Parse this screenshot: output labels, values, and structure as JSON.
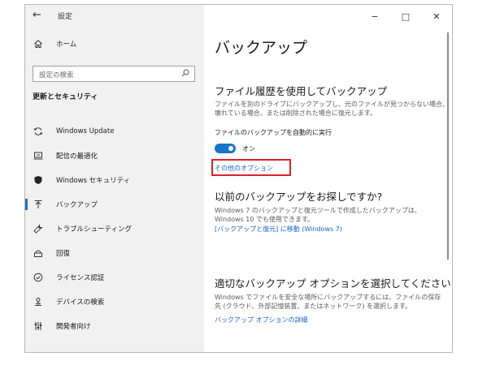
{
  "window": {
    "title": "設定",
    "back_glyph": "←",
    "controls": {
      "minimize": "−",
      "maximize": "□",
      "close": "✕"
    }
  },
  "sidebar": {
    "home_label": "ホーム",
    "search": {
      "placeholder": "設定の検索"
    },
    "section_title": "更新とセキュリティ",
    "items": [
      {
        "label": "Windows Update",
        "icon": "sync-icon"
      },
      {
        "label": "配信の最適化",
        "icon": "delivery-icon"
      },
      {
        "label": "Windows セキュリティ",
        "icon": "shield-icon"
      },
      {
        "label": "バックアップ",
        "icon": "backup-icon",
        "active": true
      },
      {
        "label": "トラブルシューティング",
        "icon": "wrench-icon"
      },
      {
        "label": "回復",
        "icon": "recovery-icon"
      },
      {
        "label": "ライセンス認証",
        "icon": "check-circle-icon"
      },
      {
        "label": "デバイスの検索",
        "icon": "find-device-icon"
      },
      {
        "label": "開発者向け",
        "icon": "developer-icon"
      }
    ]
  },
  "main": {
    "title": "バックアップ",
    "file_history": {
      "heading": "ファイル履歴を使用してバックアップ",
      "desc_line1": "ファイルを別のドライブにバックアップし、元のファイルが見つからない場合、",
      "desc_line2": "壊れている場合、または削除された場合に復元します。",
      "auto_label": "ファイルのバックアップを自動的に実行",
      "toggle_state": "オン",
      "more_options": "その他のオプション"
    },
    "older_backup": {
      "heading": "以前のバックアップをお探しですか?",
      "desc_line1": "Windows 7 のバックアップと復元ツールで作成したバックアップは、",
      "desc_line2": "Windows 10 でも使用できます。",
      "link": "[バックアップと復元] に移動 (Windows 7)"
    },
    "choose_option": {
      "heading": "適切なバックアップ オプションを選択してください",
      "desc_line1": "Windows でファイルを安全な場所にバックアップするには、ファイルの保存",
      "desc_line2": "先 (クラウド、外部記憶装置、またはネットワーク) を選択します。",
      "link": "バックアップ オプションの詳細"
    }
  },
  "colors": {
    "accent": "#1a73c7",
    "link": "#1a66c4",
    "highlight": "#e0202a",
    "sidebar_bg": "#f1f1f1"
  }
}
